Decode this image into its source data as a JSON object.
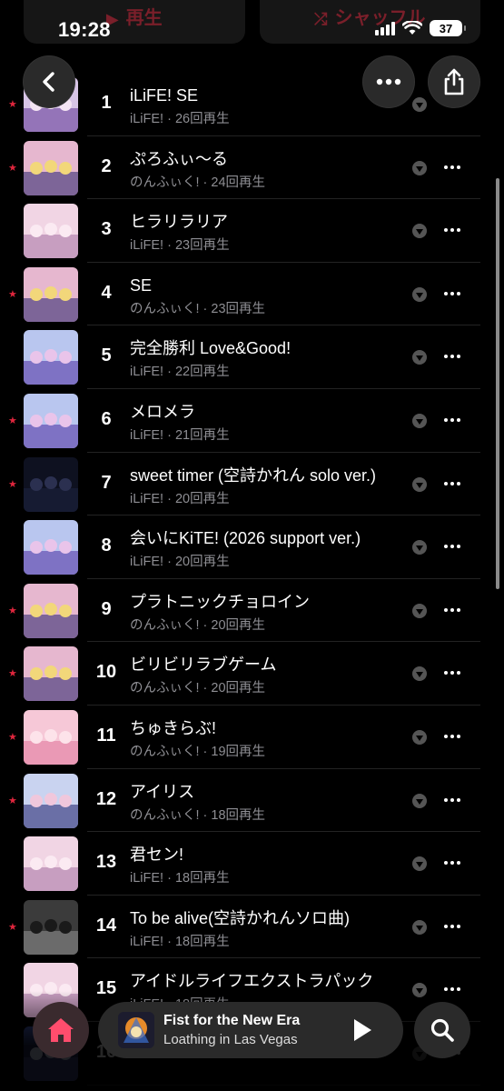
{
  "status": {
    "time": "19:28",
    "battery": "37"
  },
  "top_buttons": {
    "play_label": "再生",
    "shuffle_label": "シャッフル"
  },
  "nav": {
    "back_icon": "chevron-left-icon",
    "more_icon": "ellipsis-icon",
    "share_icon": "share-icon"
  },
  "tracks": [
    {
      "num": "1",
      "title": "iLiFE! SE",
      "artist": "iLiFE!",
      "plays": "26回再生",
      "starred": true,
      "art": [
        "#d7c4e6",
        "#7e5aa8",
        "#f4e4f3"
      ]
    },
    {
      "num": "2",
      "title": "ぷろふぃ〜る",
      "artist": "のんふぃく!",
      "plays": "24回再生",
      "starred": true,
      "art": [
        "#e6b7cf",
        "#5a4a86",
        "#f2d77a"
      ]
    },
    {
      "num": "3",
      "title": "ヒラリラリア",
      "artist": "iLiFE!",
      "plays": "23回再生",
      "starred": false,
      "art": [
        "#f1d5e4",
        "#b88bb4",
        "#fbeaf2"
      ]
    },
    {
      "num": "4",
      "title": "SE",
      "artist": "のんふぃく!",
      "plays": "23回再生",
      "starred": true,
      "art": [
        "#e6b7cf",
        "#5a4a86",
        "#f2d77a"
      ]
    },
    {
      "num": "5",
      "title": "完全勝利 Love&Good!",
      "artist": "iLiFE!",
      "plays": "22回再生",
      "starred": false,
      "art": [
        "#b9c6ef",
        "#6b55b5",
        "#e9c4ea"
      ]
    },
    {
      "num": "6",
      "title": "メロメラ",
      "artist": "iLiFE!",
      "plays": "21回再生",
      "starred": true,
      "art": [
        "#b9c6ef",
        "#6b55b5",
        "#e9c4ea"
      ]
    },
    {
      "num": "7",
      "title": "sweet timer (空詩かれん solo ver.)",
      "artist": "iLiFE!",
      "plays": "20回再生",
      "starred": true,
      "art": [
        "#0e1120",
        "#1a1f38",
        "#2b3050"
      ]
    },
    {
      "num": "8",
      "title": "会いにKiTE! (2026 support ver.)",
      "artist": "iLiFE!",
      "plays": "20回再生",
      "starred": false,
      "art": [
        "#b9c6ef",
        "#6b55b5",
        "#e9c4ea"
      ]
    },
    {
      "num": "9",
      "title": "プラトニックチョロイン",
      "artist": "のんふぃく!",
      "plays": "20回再生",
      "starred": true,
      "art": [
        "#e6b7cf",
        "#5a4a86",
        "#f2d77a"
      ]
    },
    {
      "num": "10",
      "title": "ビリビリラブゲーム",
      "artist": "のんふぃく!",
      "plays": "20回再生",
      "starred": true,
      "art": [
        "#e6b7cf",
        "#5a4a86",
        "#f2d77a"
      ]
    },
    {
      "num": "11",
      "title": "ちゅきらぶ!",
      "artist": "のんふぃく!",
      "plays": "19回再生",
      "starred": true,
      "art": [
        "#f6c8d7",
        "#e58aa9",
        "#fde3ea"
      ]
    },
    {
      "num": "12",
      "title": "アイリス",
      "artist": "のんふぃく!",
      "plays": "18回再生",
      "starred": true,
      "art": [
        "#c9d3f0",
        "#4a4e8e",
        "#f0c7dc"
      ]
    },
    {
      "num": "13",
      "title": "君セン!",
      "artist": "iLiFE!",
      "plays": "18回再生",
      "starred": false,
      "art": [
        "#f1d5e4",
        "#b88bb4",
        "#fbeaf2"
      ]
    },
    {
      "num": "14",
      "title": "To be alive(空詩かれんソロ曲)",
      "artist": "iLiFE!",
      "plays": "18回再生",
      "starred": true,
      "art": [
        "#3b3b3b",
        "#7c7c7c",
        "#1a1a1a"
      ]
    },
    {
      "num": "15",
      "title": "アイドルライフエクストラパック",
      "artist": "iLiFE!",
      "plays": "18回再生",
      "starred": false,
      "art": [
        "#f1d5e4",
        "#b88bb4",
        "#fbeaf2"
      ]
    },
    {
      "num": "16",
      "title": "",
      "artist": "",
      "plays": "",
      "starred": false,
      "art": [
        "#1f2a56",
        "#4a4e8e",
        "#c9d3f0"
      ]
    }
  ],
  "now_playing": {
    "title": "Fist for the New Era",
    "artist": "Loathing in Las Vegas"
  },
  "colors": {
    "accent": "#e0263d",
    "background": "#000000",
    "secondary_text": "#8e8e93"
  }
}
